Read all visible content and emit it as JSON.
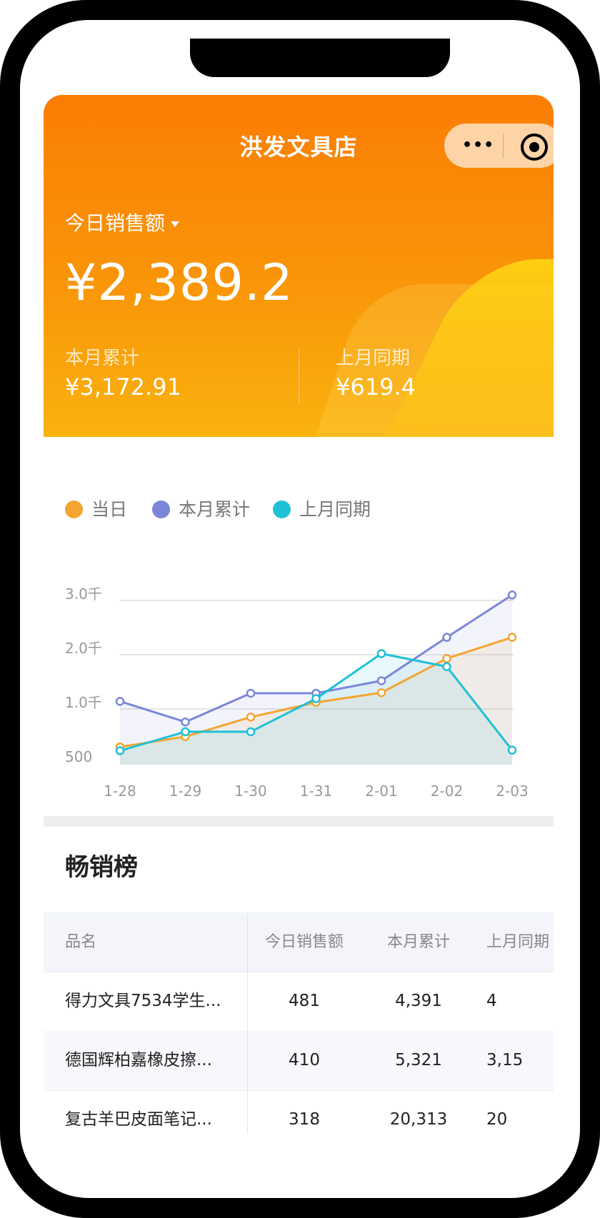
{
  "app": {
    "title": "洪发文具店"
  },
  "capsule": {
    "more_icon": "more-dots-icon",
    "close_icon": "target-circle-icon",
    "dots": "•••"
  },
  "summary": {
    "label": "今日销售额",
    "value": "¥2,389.2",
    "month_label": "本月累计",
    "month_value": "¥3,172.91",
    "last_label": "上月同期",
    "last_value": "¥619.4"
  },
  "legend": [
    "当日",
    "本月累计",
    "上月同期"
  ],
  "colors": {
    "daily": "#f4a531",
    "monthly": "#7b86d8",
    "last": "#1fc1d6",
    "accent": "#fb7d04"
  },
  "chart_data": {
    "type": "line",
    "x": [
      "1-28",
      "1-29",
      "1-30",
      "1-31",
      "2-01",
      "2-02",
      "2-03"
    ],
    "y_ticks": [
      "500",
      "1.0千",
      "2.0千",
      "3.0千"
    ],
    "series": [
      {
        "name": "当日",
        "values": [
          300,
          490,
          850,
          1120,
          1300,
          1930,
          2320
        ]
      },
      {
        "name": "本月累计",
        "values": [
          1140,
          760,
          1290,
          1290,
          1520,
          2320,
          3100
        ]
      },
      {
        "name": "上月同期",
        "values": [
          230,
          580,
          580,
          1190,
          2020,
          1780,
          240
        ]
      }
    ]
  },
  "bestsellers": {
    "title": "畅销榜",
    "headers": [
      "品名",
      "今日销售额",
      "本月累计",
      "上月同期"
    ],
    "rows": [
      {
        "name": "得力文具7534学生...",
        "today": "481",
        "month": "4,391",
        "last": "4"
      },
      {
        "name": "德国辉柏嘉橡皮擦...",
        "today": "410",
        "month": "5,321",
        "last": "3,15"
      },
      {
        "name": "复古羊巴皮面笔记...",
        "today": "318",
        "month": "20,313",
        "last": "20"
      }
    ]
  }
}
